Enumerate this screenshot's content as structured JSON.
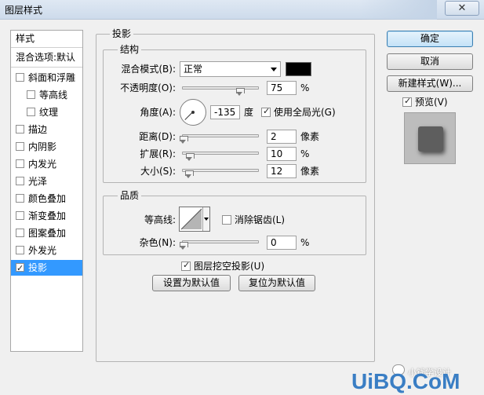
{
  "window": {
    "title": "图层样式",
    "close_label": "✕"
  },
  "sidebar": {
    "items": [
      {
        "label": "样式",
        "checkbox": false,
        "checked": false,
        "indent": 0
      },
      {
        "label": "混合选项:默认",
        "checkbox": false,
        "checked": false,
        "indent": 0
      },
      {
        "label": "斜面和浮雕",
        "checkbox": true,
        "checked": false,
        "indent": 0
      },
      {
        "label": "等高线",
        "checkbox": true,
        "checked": false,
        "indent": 1
      },
      {
        "label": "纹理",
        "checkbox": true,
        "checked": false,
        "indent": 1
      },
      {
        "label": "描边",
        "checkbox": true,
        "checked": false,
        "indent": 0
      },
      {
        "label": "内阴影",
        "checkbox": true,
        "checked": false,
        "indent": 0
      },
      {
        "label": "内发光",
        "checkbox": true,
        "checked": false,
        "indent": 0
      },
      {
        "label": "光泽",
        "checkbox": true,
        "checked": false,
        "indent": 0
      },
      {
        "label": "颜色叠加",
        "checkbox": true,
        "checked": false,
        "indent": 0
      },
      {
        "label": "渐变叠加",
        "checkbox": true,
        "checked": false,
        "indent": 0
      },
      {
        "label": "图案叠加",
        "checkbox": true,
        "checked": false,
        "indent": 0
      },
      {
        "label": "外发光",
        "checkbox": true,
        "checked": false,
        "indent": 0
      },
      {
        "label": "投影",
        "checkbox": true,
        "checked": true,
        "indent": 0,
        "selected": true
      }
    ]
  },
  "main": {
    "section_title": "投影",
    "structure": {
      "title": "结构",
      "blend_mode_label": "混合模式(B):",
      "blend_mode_value": "正常",
      "shadow_color": "#000000",
      "opacity_label": "不透明度(O):",
      "opacity_value": "75",
      "opacity_fraction": 0.75,
      "percent": "%",
      "angle_label": "角度(A):",
      "angle_value": "-135",
      "angle_unit": "度",
      "global_light_label": "使用全局光(G)",
      "global_light_checked": true,
      "distance_label": "距离(D):",
      "distance_value": "2",
      "pixel_unit": "像素",
      "spread_label": "扩展(R):",
      "spread_value": "10",
      "size_label": "大小(S):",
      "size_value": "12"
    },
    "quality": {
      "title": "品质",
      "contour_label": "等高线:",
      "antialias_label": "消除锯齿(L)",
      "antialias_checked": false,
      "noise_label": "杂色(N):",
      "noise_value": "0"
    },
    "knockout_label": "图层挖空投影(U)",
    "knockout_checked": true,
    "set_default_label": "设置为默认值",
    "reset_default_label": "复位为默认值"
  },
  "right": {
    "ok_label": "确定",
    "cancel_label": "取消",
    "new_style_label": "新建样式(W)...",
    "preview_label": "预览(V)",
    "preview_checked": true
  },
  "watermark": {
    "brand": "UiBQ.CoM",
    "caption": "小钱学设计"
  },
  "colors": {
    "selection": "#3399ff",
    "shadow": "#000000",
    "accent": "#3c7fb1"
  }
}
